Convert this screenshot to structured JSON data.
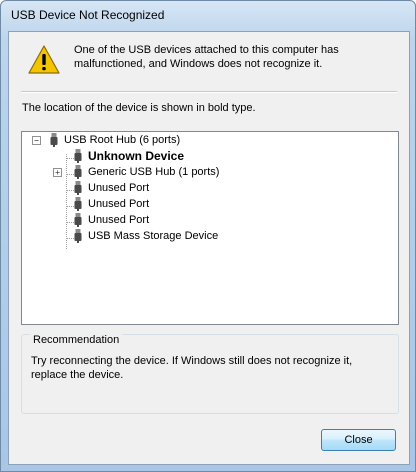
{
  "window": {
    "title": "USB Device Not Recognized"
  },
  "message": "One of the USB devices attached to this computer has malfunctioned, and Windows does not recognize it.",
  "location_hint": "The location of the device is shown in bold type.",
  "tree": {
    "root": {
      "label": "USB Root Hub (6 ports)",
      "expander": "−"
    },
    "children": [
      {
        "label": "Unknown Device",
        "bold": true
      },
      {
        "label": "Generic USB Hub (1 ports)",
        "expander": "+"
      },
      {
        "label": "Unused Port"
      },
      {
        "label": "Unused Port"
      },
      {
        "label": "Unused Port"
      },
      {
        "label": "USB Mass Storage Device"
      }
    ]
  },
  "recommendation": {
    "heading": "Recommendation",
    "text": "Try reconnecting the device. If Windows still does not recognize it, replace the device."
  },
  "buttons": {
    "close": "Close"
  },
  "colors": {
    "warning": "#f5c400",
    "accent": "#3c7fb1"
  }
}
